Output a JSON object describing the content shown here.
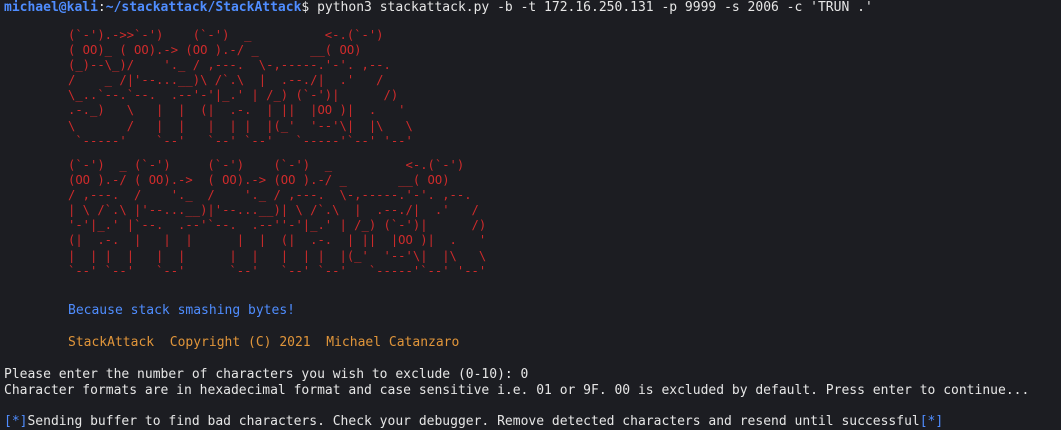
{
  "prompt": {
    "user_host": "michael@kali",
    "sep": ":",
    "path": "~/stackattack/StackAttack",
    "symbol": "$",
    "command": " python3 stackattack.py -b -t 172.16.250.131 -p 9999 -s 2006 -c 'TRUN .'"
  },
  "banner": {
    "art_top": "(`-').->>`-')    (`-')  _          <-.(`-')\n( OO)_ ( OO).-> (OO ).-/ _       __( OO)\n(_)--\\_)/    '._ / ,---.  \\-,-----.'-'. ,--.\n/    _ /|'--...__)\\ /`.\\  |  .--./|  .'   /\n\\_..`--.`--.  .--'-'|_.' | /_) (`-')|      /)\n.-._)   \\   |  |  (|  .-.  | ||  |OO )|  .   '\n\\       /   |  |   |  | |  |(_'  '--'\\|  |\\   \\\n `-----'    `--'   `--' `--'   `-----'`--' '--'",
    "art_bottom": "(`-')  _ (`-')     (`-')    (`-')  _          <-.(`-')\n(OO ).-/ ( OO).->  ( OO).-> (OO ).-/ _       __( OO)\n/ ,---.  /    '._  /    '._ / ,---.  \\-,-----.'-'. ,--.\n| \\ /`.\\ |'--...__)|'--...__)| \\ /`.\\  |  .--./|  .'   /\n'-'|_.' |`--.  .--'`--.  .--''-'|_.' | /_) (`-')|      /)\n(|  .-.  |   |  |      |  |  (|  .-.  | ||  |OO )|  .   '\n|  | |  |   |  |      |  |   |  | |  |(_'  '--'\\|  |\\   \\\n`--' `--'   `--'      `--'   `--' `--'   `-----'`--' '--'",
    "tagline": "Because stack smashing bytes!",
    "copyright": "StackAttack  Copyright (C) 2021  Michael Catanzaro"
  },
  "output": {
    "exclude_prompt": "Please enter the number of characters you wish to exclude (0-10): 0",
    "format_info": "Character formats are in hexadecimal format and case sensitive i.e. 01 or 9F. 00 is excluded by default. Press enter to continue...",
    "status_open": "[*]",
    "status_text": "Sending buffer to find bad characters. Check your debugger. Remove detected characters and resend until successful",
    "status_close": "[*]"
  },
  "colors": {
    "background": "#1c1d22",
    "prompt": "#4f8dff",
    "art": "#d02b2b",
    "tagline": "#4f8dff",
    "copyright": "#e0953a"
  }
}
